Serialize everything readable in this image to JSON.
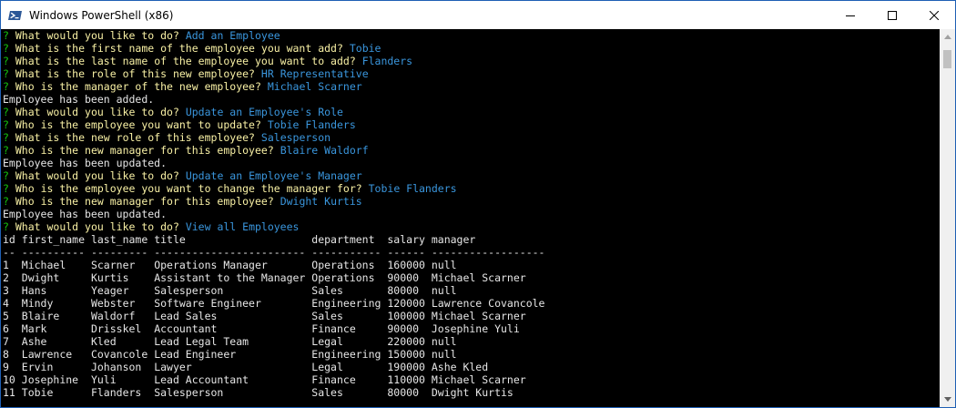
{
  "window": {
    "title": "Windows PowerShell (x86)",
    "icon": "powershell-icon"
  },
  "colors": {
    "prompt_marker": "#16c60c",
    "question": "#f9f1a5",
    "answer": "#3a96dd",
    "output": "#e6e6e6"
  },
  "console": {
    "session": [
      {
        "marker": "?",
        "q": "What would you like to do?",
        "a": "Add an Employee"
      },
      {
        "marker": "?",
        "q": "What is the first name of the employee you want add?",
        "a": "Tobie"
      },
      {
        "marker": "?",
        "q": "What is the last name of the employee you want to add?",
        "a": "Flanders"
      },
      {
        "marker": "?",
        "q": "What is the role of this new employee?",
        "a": "HR Representative"
      },
      {
        "marker": "?",
        "q": "Who is the manager of the new employee?",
        "a": "Michael Scarner"
      },
      {
        "text": "Employee has been added."
      },
      {
        "marker": "?",
        "q": "What would you like to do?",
        "a": "Update an Employee's Role"
      },
      {
        "marker": "?",
        "q": "Who is the employee you want to update?",
        "a": "Tobie Flanders"
      },
      {
        "marker": "?",
        "q": "What is the new role of this employee?",
        "a": "Salesperson"
      },
      {
        "marker": "?",
        "q": "Who is the new manager for this employee?",
        "a": "Blaire Waldorf"
      },
      {
        "text": "Employee has been updated."
      },
      {
        "marker": "?",
        "q": "What would you like to do?",
        "a": "Update an Employee's Manager"
      },
      {
        "marker": "?",
        "q": "Who is the employee you want to change the manager for?",
        "a": "Tobie Flanders"
      },
      {
        "marker": "?",
        "q": "Who is the new manager for this employee?",
        "a": "Dwight Kurtis"
      },
      {
        "text": "Employee has been updated."
      },
      {
        "marker": "?",
        "q": "What would you like to do?",
        "a": "View all Employees"
      }
    ],
    "table": {
      "columns": [
        "id",
        "first_name",
        "last_name",
        "title",
        "department",
        "salary",
        "manager"
      ],
      "separators": [
        "--",
        "----------",
        "---------",
        "------------------------",
        "-----------",
        "------",
        "------------------"
      ],
      "rows": [
        [
          "1",
          "Michael",
          "Scarner",
          "Operations Manager",
          "Operations",
          "160000",
          "null"
        ],
        [
          "2",
          "Dwight",
          "Kurtis",
          "Assistant to the Manager",
          "Operations",
          "90000",
          "Michael Scarner"
        ],
        [
          "3",
          "Hans",
          "Yeager",
          "Salesperson",
          "Sales",
          "80000",
          "null"
        ],
        [
          "4",
          "Mindy",
          "Webster",
          "Software Engineer",
          "Engineering",
          "120000",
          "Lawrence Covancole"
        ],
        [
          "5",
          "Blaire",
          "Waldorf",
          "Lead Sales",
          "Sales",
          "100000",
          "Michael Scarner"
        ],
        [
          "6",
          "Mark",
          "Drisskel",
          "Accountant",
          "Finance",
          "90000",
          "Josephine Yuli"
        ],
        [
          "7",
          "Ashe",
          "Kled",
          "Lead Legal Team",
          "Legal",
          "220000",
          "null"
        ],
        [
          "8",
          "Lawrence",
          "Covancole",
          "Lead Engineer",
          "Engineering",
          "150000",
          "null"
        ],
        [
          "9",
          "Ervin",
          "Johanson",
          "Lawyer",
          "Legal",
          "190000",
          "Ashe Kled"
        ],
        [
          "10",
          "Josephine",
          "Yuli",
          "Lead Accountant",
          "Finance",
          "110000",
          "Michael Scarner"
        ],
        [
          "11",
          "Tobie",
          "Flanders",
          "Salesperson",
          "Sales",
          "80000",
          "Dwight Kurtis"
        ]
      ]
    }
  }
}
